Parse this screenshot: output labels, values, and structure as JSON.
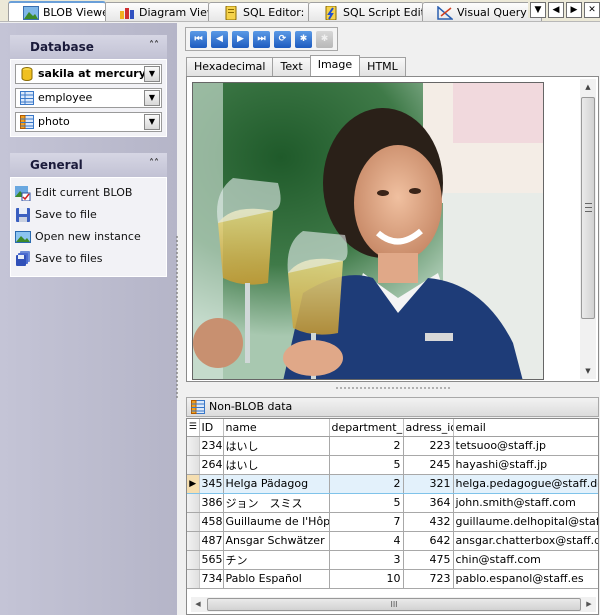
{
  "tabs": [
    {
      "label": "BLOB Viewer",
      "icon": "blob-viewer-icon",
      "active": true
    },
    {
      "label": "Diagram Viewer",
      "icon": "diagram-icon",
      "active": false
    },
    {
      "label": "SQL Editor: ...",
      "icon": "sql-editor-icon",
      "active": false
    },
    {
      "label": "SQL Script Editor",
      "icon": "sql-script-icon",
      "active": false
    },
    {
      "label": "Visual Query Buil",
      "icon": "query-builder-icon",
      "active": false
    }
  ],
  "tab_controls": {
    "dropdown": "▼",
    "prev": "◀",
    "next": "▶",
    "close": "✕"
  },
  "sidebar": {
    "database": {
      "title": "Database",
      "collapse": "⌃",
      "connection": "sakila at mercury",
      "table": "employee",
      "field": "photo"
    },
    "general": {
      "title": "General",
      "collapse": "⌃",
      "actions": [
        {
          "label": "Edit current BLOB",
          "icon": "edit-blob-icon"
        },
        {
          "label": "Save to file",
          "icon": "save-icon"
        },
        {
          "label": "Open new instance",
          "icon": "open-instance-icon"
        },
        {
          "label": "Save to files",
          "icon": "save-files-icon"
        }
      ]
    }
  },
  "navigator": {
    "buttons": [
      {
        "name": "first-record-button",
        "glyph": "⏮",
        "enabled": true
      },
      {
        "name": "prior-record-button",
        "glyph": "◀",
        "enabled": true
      },
      {
        "name": "next-record-button",
        "glyph": "▶",
        "enabled": true
      },
      {
        "name": "last-record-button",
        "glyph": "⏭",
        "enabled": true
      },
      {
        "name": "refresh-button",
        "glyph": "⟳",
        "enabled": true
      },
      {
        "name": "apply-button",
        "glyph": "✱",
        "enabled": true
      },
      {
        "name": "cancel-button",
        "glyph": "✱",
        "enabled": false
      }
    ]
  },
  "view_tabs": [
    {
      "label": "Hexadecimal",
      "active": false
    },
    {
      "label": "Text",
      "active": false
    },
    {
      "label": "Image",
      "active": true
    },
    {
      "label": "HTML",
      "active": false
    }
  ],
  "non_blob": {
    "title": "Non-BLOB data",
    "columns": [
      "ID",
      "name",
      "department_id",
      "adress_id",
      "email"
    ],
    "rows": [
      {
        "id": "234",
        "name": "はいし",
        "department_id": "2",
        "adress_id": "223",
        "email": "tetsuoo@staff.jp",
        "selected": false
      },
      {
        "id": "264",
        "name": "はいし",
        "department_id": "5",
        "adress_id": "245",
        "email": "hayashi@staff.jp",
        "selected": false
      },
      {
        "id": "345",
        "name": "Helga Pädagog",
        "department_id": "2",
        "adress_id": "321",
        "email": "helga.pedagogue@staff.de",
        "selected": true
      },
      {
        "id": "386",
        "name": "ジョン　スミス",
        "department_id": "5",
        "adress_id": "364",
        "email": "john.smith@staff.com",
        "selected": false
      },
      {
        "id": "458",
        "name": "Guillaume de l'Hôpital",
        "department_id": "7",
        "adress_id": "432",
        "email": "guillaume.delhopital@staff.es",
        "selected": false
      },
      {
        "id": "487",
        "name": "Ansgar Schwätzer",
        "department_id": "4",
        "adress_id": "642",
        "email": "ansgar.chatterbox@staff.de",
        "selected": false
      },
      {
        "id": "565",
        "name": "チン",
        "department_id": "3",
        "adress_id": "475",
        "email": "chin@staff.com",
        "selected": false
      },
      {
        "id": "734",
        "name": "Pablo Español",
        "department_id": "10",
        "adress_id": "723",
        "email": "pablo.espanol@staff.es",
        "selected": false
      }
    ],
    "current_row_marker": "▶",
    "scroll_grip": "III"
  },
  "colors": {
    "sidebar_bg": "#b9b9cc",
    "selected_row": "#e3f1fb",
    "nav_button": "#2a6fd0",
    "active_tab_accent": "#6a9fd8"
  }
}
